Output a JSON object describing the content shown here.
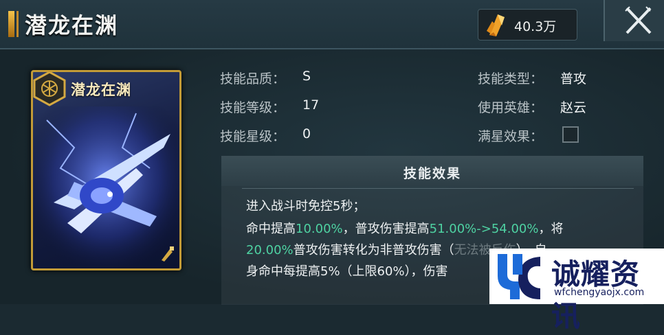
{
  "header": {
    "title": "潜龙在渊",
    "currency_value": "40.3万",
    "close_icon": "close-x-icon"
  },
  "skill_card": {
    "title": "潜龙在渊",
    "emblem_icon": "hexagon-emblem-icon"
  },
  "attributes": {
    "quality": {
      "label": "技能品质：",
      "value": "S"
    },
    "level": {
      "label": "技能等级：",
      "value": "17"
    },
    "stars": {
      "label": "技能星级：",
      "value": "0"
    },
    "type": {
      "label": "技能类型：",
      "value": "普攻"
    },
    "hero": {
      "label": "使用英雄：",
      "value": "赵云"
    },
    "max_star": {
      "label": "满星效果："
    }
  },
  "effect": {
    "title": "技能效果",
    "line1": "进入战斗时免控5秒；",
    "line2_a": "命中提高",
    "line2_b": "10.00%",
    "line2_c": "，普攻伤害提高",
    "line2_d": "51.00%->54.00%",
    "line2_e": "，将",
    "line3_a": "20.00%",
    "line3_b": "普攻伤害转化为非普攻伤害（",
    "line3_c": "无法被反伤",
    "line3_d": "），自",
    "line4": "身命中每提高5%（上限60%），伤害"
  },
  "watermark": {
    "text": "诚耀资讯",
    "url": "wfchengyaojx.com"
  },
  "colors": {
    "highlight_green": "#4ed2a2",
    "card_gold": "#c39b37",
    "background": "#1b2a31"
  }
}
